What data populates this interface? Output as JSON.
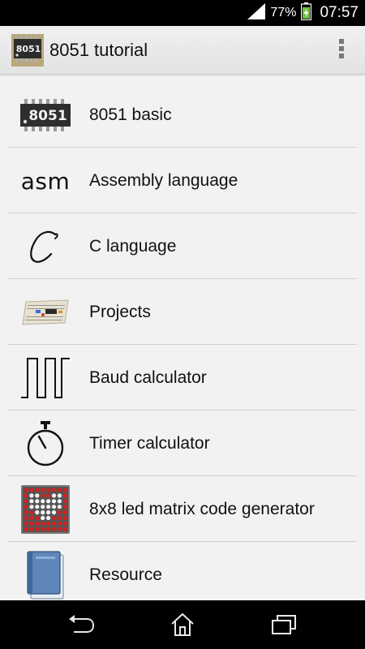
{
  "status_bar": {
    "battery_percent": "77%",
    "time": "07:57",
    "icons": [
      "signal-icon",
      "battery-charging-icon"
    ]
  },
  "app_bar": {
    "title": "8051 tutorial",
    "icon": "chip-8051-icon",
    "chip_label": "8051",
    "overflow_icon": "more-vert-icon"
  },
  "menu": {
    "items": [
      {
        "label": "8051 basic",
        "icon": "chip-8051-icon",
        "icon_text": "8051"
      },
      {
        "label": "Assembly language",
        "icon": "asm-text-icon",
        "icon_text": "asm"
      },
      {
        "label": "C language",
        "icon": "script-c-icon"
      },
      {
        "label": "Projects",
        "icon": "breadboard-icon"
      },
      {
        "label": "Baud calculator",
        "icon": "square-wave-icon"
      },
      {
        "label": "Timer calculator",
        "icon": "stopwatch-icon"
      },
      {
        "label": "8x8 led matrix code generator",
        "icon": "led-matrix-icon"
      },
      {
        "label": "Resource",
        "icon": "book-icon"
      }
    ]
  },
  "nav_bar": {
    "buttons": [
      "back-icon",
      "home-icon",
      "recents-icon"
    ]
  },
  "colors": {
    "status_bar_bg": "#000000",
    "action_bar_bg": "#e8e8e8",
    "list_bg": "#f2f2f2",
    "divider": "#cfcfcf",
    "led_red": "#d32020",
    "battery_green": "#6fbf3a"
  }
}
